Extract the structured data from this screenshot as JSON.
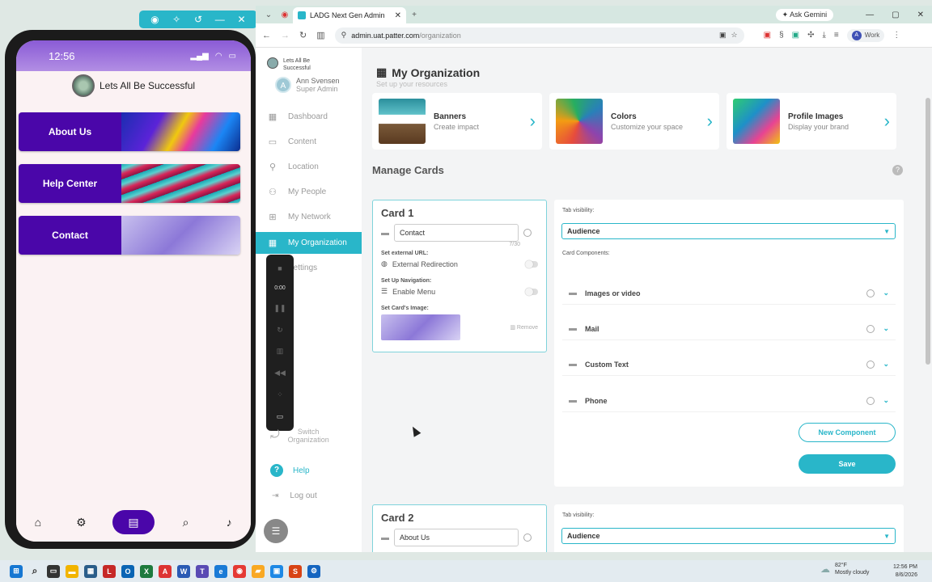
{
  "phone": {
    "time": "12:56",
    "app_title": "Lets All Be Successful",
    "cards": [
      {
        "label": "About Us"
      },
      {
        "label": "Help Center"
      },
      {
        "label": "Contact"
      }
    ]
  },
  "browser": {
    "tab_title": "LADG Next Gen Admin",
    "gemini": "Ask Gemini",
    "url_host": "admin.uat.patter.com",
    "url_path": "/organization",
    "profile": "Work",
    "profile_initial": "A"
  },
  "sidebar": {
    "org_name": "Lets All Be Successful",
    "user_initial": "A",
    "user_name": "Ann Svensen",
    "user_role": "Super Admin",
    "items": [
      {
        "label": "Dashboard",
        "icon": "dashboard-icon"
      },
      {
        "label": "Content",
        "icon": "content-icon"
      },
      {
        "label": "Location",
        "icon": "location-pin-icon"
      },
      {
        "label": "My People",
        "icon": "people-icon"
      },
      {
        "label": "My Network",
        "icon": "network-icon"
      },
      {
        "label": "My Organization",
        "icon": "organization-icon"
      },
      {
        "label": "Settings",
        "icon": "settings-icon"
      }
    ],
    "recorder_time": "0:00",
    "switch_org_line1": "Switch",
    "switch_org_line2": "Organization",
    "help": "Help",
    "logout": "Log out"
  },
  "main": {
    "title": "My Organization",
    "subtitle": "Set up your resources",
    "resources": [
      {
        "title": "Banners",
        "desc": "Create impact"
      },
      {
        "title": "Colors",
        "desc": "Customize your space"
      },
      {
        "title": "Profile Images",
        "desc": "Display your brand"
      }
    ],
    "manage_cards_title": "Manage Cards",
    "card1": {
      "title": "Card 1",
      "name": "Contact",
      "counter": "7/30",
      "external_url_label": "Set external URL:",
      "external_redirection": "External Redirection",
      "navigation_label": "Set Up Navigation:",
      "enable_menu": "Enable Menu",
      "image_label": "Set Card's Image:",
      "remove": "Remove"
    },
    "panel1": {
      "tab_visibility_label": "Tab visibility:",
      "audience": "Audience",
      "components_label": "Card Components:",
      "components": [
        "Images or video",
        "Mail",
        "Custom Text",
        "Phone"
      ],
      "new_component": "New Component",
      "save": "Save"
    },
    "card2": {
      "title": "Card 2",
      "name": "About Us"
    },
    "panel2": {
      "tab_visibility_label": "Tab visibility:",
      "audience": "Audience"
    }
  },
  "taskbar": {
    "temp": "82°F",
    "weather": "Mostly cloudy",
    "time": "12:56 PM",
    "date": "8/6/2026"
  },
  "colors": {
    "accent": "#29b6c9",
    "phone_card": "#4a06a9"
  }
}
